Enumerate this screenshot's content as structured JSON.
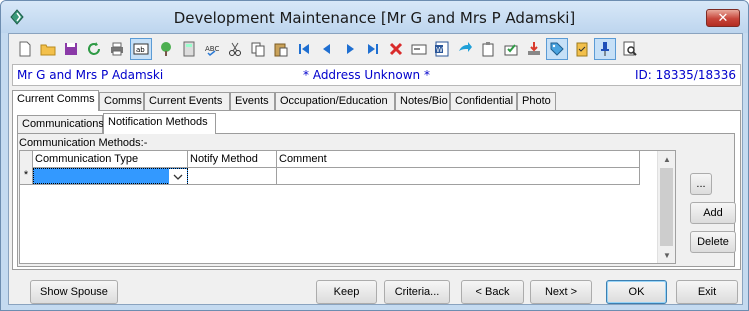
{
  "window": {
    "title": "Development Maintenance  [Mr G and Mrs P Adamski]",
    "close_label": "✕"
  },
  "toolbar": {
    "icons": [
      "new-document-icon",
      "open-folder-icon",
      "save-icon",
      "refresh-icon",
      "print-icon",
      "text-field-icon",
      "tree-icon",
      "calculator-icon",
      "spell-check-icon",
      "cut-icon",
      "copy-icon",
      "paste-icon",
      "first-record-icon",
      "previous-record-icon",
      "next-record-icon",
      "last-record-icon",
      "delete-icon",
      "card-icon",
      "word-document-icon",
      "forward-icon",
      "clipboard-icon",
      "approve-icon",
      "download-icon",
      "tag-icon",
      "checklist-icon",
      "pin-icon",
      "preview-icon"
    ],
    "pressed": [
      "text-field-icon",
      "tag-icon",
      "pin-icon"
    ]
  },
  "info": {
    "name": "Mr G and Mrs P Adamski",
    "status": "* Address Unknown *",
    "id": "ID: 18335/18336"
  },
  "main_tabs": [
    "Current Comms",
    "Comms",
    "Current Events",
    "Events",
    "Occupation/Education",
    "Notes/Bio",
    "Confidential",
    "Photo"
  ],
  "main_tab_active": "Current Comms",
  "sub_tabs": [
    "Communications",
    "Notification Methods"
  ],
  "sub_tab_active": "Notification Methods",
  "section": {
    "label": "Communication Methods:-"
  },
  "grid": {
    "columns": [
      "Communication Type",
      "Notify Method",
      "Comment"
    ],
    "rows": [
      {
        "marker": "*",
        "communication_type": "",
        "notify_method": "",
        "comment": ""
      }
    ]
  },
  "side_buttons": {
    "more": "...",
    "add": "Add",
    "delete": "Delete"
  },
  "buttons": {
    "show_spouse": "Show Spouse",
    "keep": "Keep",
    "criteria": "Criteria...",
    "back": "< Back",
    "next": "Next >",
    "ok": "OK",
    "exit": "Exit"
  }
}
